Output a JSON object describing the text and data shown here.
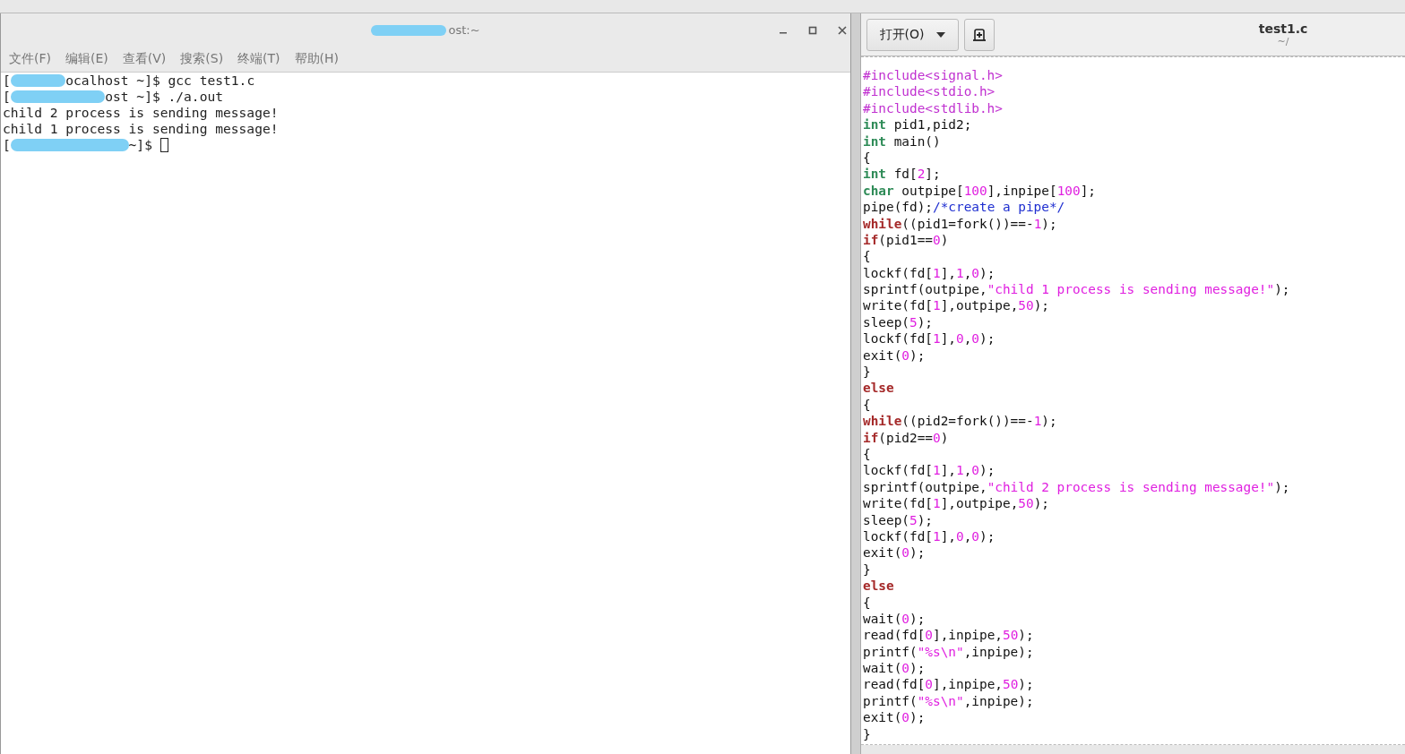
{
  "terminal": {
    "title": "ost:~",
    "menu": [
      "文件(F)",
      "编辑(E)",
      "查看(V)",
      "搜索(S)",
      "终端(T)",
      "帮助(H)"
    ],
    "lines": [
      {
        "prefix": "[",
        "text": "ocalhost ~]$ gcc test1.c",
        "redacted": true,
        "cursor": false
      },
      {
        "prefix": "[",
        "text": "ost ~]$ ./a.out",
        "redacted": true,
        "cursor": false
      },
      {
        "text": "child 2 process is sending message!",
        "redacted": false,
        "cursor": false
      },
      {
        "text": "child 1 process is sending message!",
        "redacted": false,
        "cursor": false
      },
      {
        "prefix": "[",
        "text": "~]$",
        "redacted": true,
        "cursor": true
      }
    ]
  },
  "editor": {
    "open_button": "打开(O)",
    "title": "test1.c",
    "subtitle": "~/",
    "code": [
      [
        {
          "kind": "pre",
          "text": "#include<signal.h>"
        }
      ],
      [
        {
          "kind": "pre",
          "text": "#include<stdio.h>"
        }
      ],
      [
        {
          "kind": "pre",
          "text": "#include<stdlib.h>"
        }
      ],
      [
        {
          "kind": "type",
          "text": "int"
        },
        {
          "kind": "plain",
          "text": " pid1,pid2;"
        }
      ],
      [
        {
          "kind": "type",
          "text": "int"
        },
        {
          "kind": "plain",
          "text": " main()"
        }
      ],
      [
        {
          "kind": "plain",
          "text": "{"
        }
      ],
      [
        {
          "kind": "type",
          "text": "int"
        },
        {
          "kind": "plain",
          "text": " fd["
        },
        {
          "kind": "num",
          "text": "2"
        },
        {
          "kind": "plain",
          "text": "];"
        }
      ],
      [
        {
          "kind": "type",
          "text": "char"
        },
        {
          "kind": "plain",
          "text": " outpipe["
        },
        {
          "kind": "num",
          "text": "100"
        },
        {
          "kind": "plain",
          "text": "],inpipe["
        },
        {
          "kind": "num",
          "text": "100"
        },
        {
          "kind": "plain",
          "text": "];"
        }
      ],
      [
        {
          "kind": "plain",
          "text": "pipe(fd);"
        },
        {
          "kind": "comment",
          "text": "/*create a pipe*/"
        }
      ],
      [
        {
          "kind": "keyword",
          "text": "while"
        },
        {
          "kind": "plain",
          "text": "((pid1=fork())==-"
        },
        {
          "kind": "num",
          "text": "1"
        },
        {
          "kind": "plain",
          "text": ");"
        }
      ],
      [
        {
          "kind": "keyword",
          "text": "if"
        },
        {
          "kind": "plain",
          "text": "(pid1=="
        },
        {
          "kind": "num",
          "text": "0"
        },
        {
          "kind": "plain",
          "text": ")"
        }
      ],
      [
        {
          "kind": "plain",
          "text": "{"
        }
      ],
      [
        {
          "kind": "plain",
          "text": "lockf(fd["
        },
        {
          "kind": "num",
          "text": "1"
        },
        {
          "kind": "plain",
          "text": "],"
        },
        {
          "kind": "num",
          "text": "1"
        },
        {
          "kind": "plain",
          "text": ","
        },
        {
          "kind": "num",
          "text": "0"
        },
        {
          "kind": "plain",
          "text": ");"
        }
      ],
      [
        {
          "kind": "plain",
          "text": "sprintf(outpipe,"
        },
        {
          "kind": "str",
          "text": "\"child 1 process is sending message!\""
        },
        {
          "kind": "plain",
          "text": ");"
        }
      ],
      [
        {
          "kind": "plain",
          "text": "write(fd["
        },
        {
          "kind": "num",
          "text": "1"
        },
        {
          "kind": "plain",
          "text": "],outpipe,"
        },
        {
          "kind": "num",
          "text": "50"
        },
        {
          "kind": "plain",
          "text": ");"
        }
      ],
      [
        {
          "kind": "plain",
          "text": "sleep("
        },
        {
          "kind": "num",
          "text": "5"
        },
        {
          "kind": "plain",
          "text": ");"
        }
      ],
      [
        {
          "kind": "plain",
          "text": "lockf(fd["
        },
        {
          "kind": "num",
          "text": "1"
        },
        {
          "kind": "plain",
          "text": "],"
        },
        {
          "kind": "num",
          "text": "0"
        },
        {
          "kind": "plain",
          "text": ","
        },
        {
          "kind": "num",
          "text": "0"
        },
        {
          "kind": "plain",
          "text": ");"
        }
      ],
      [
        {
          "kind": "plain",
          "text": "exit("
        },
        {
          "kind": "num",
          "text": "0"
        },
        {
          "kind": "plain",
          "text": ");"
        }
      ],
      [
        {
          "kind": "plain",
          "text": "}"
        }
      ],
      [
        {
          "kind": "keyword",
          "text": "else"
        }
      ],
      [
        {
          "kind": "plain",
          "text": "{"
        }
      ],
      [
        {
          "kind": "keyword",
          "text": "while"
        },
        {
          "kind": "plain",
          "text": "((pid2=fork())==-"
        },
        {
          "kind": "num",
          "text": "1"
        },
        {
          "kind": "plain",
          "text": ");"
        }
      ],
      [
        {
          "kind": "keyword",
          "text": "if"
        },
        {
          "kind": "plain",
          "text": "(pid2=="
        },
        {
          "kind": "num",
          "text": "0"
        },
        {
          "kind": "plain",
          "text": ")"
        }
      ],
      [
        {
          "kind": "plain",
          "text": "{"
        }
      ],
      [
        {
          "kind": "plain",
          "text": "lockf(fd["
        },
        {
          "kind": "num",
          "text": "1"
        },
        {
          "kind": "plain",
          "text": "],"
        },
        {
          "kind": "num",
          "text": "1"
        },
        {
          "kind": "plain",
          "text": ","
        },
        {
          "kind": "num",
          "text": "0"
        },
        {
          "kind": "plain",
          "text": ");"
        }
      ],
      [
        {
          "kind": "plain",
          "text": "sprintf(outpipe,"
        },
        {
          "kind": "str",
          "text": "\"child 2 process is sending message!\""
        },
        {
          "kind": "plain",
          "text": ");"
        }
      ],
      [
        {
          "kind": "plain",
          "text": "write(fd["
        },
        {
          "kind": "num",
          "text": "1"
        },
        {
          "kind": "plain",
          "text": "],outpipe,"
        },
        {
          "kind": "num",
          "text": "50"
        },
        {
          "kind": "plain",
          "text": ");"
        }
      ],
      [
        {
          "kind": "plain",
          "text": "sleep("
        },
        {
          "kind": "num",
          "text": "5"
        },
        {
          "kind": "plain",
          "text": ");"
        }
      ],
      [
        {
          "kind": "plain",
          "text": "lockf(fd["
        },
        {
          "kind": "num",
          "text": "1"
        },
        {
          "kind": "plain",
          "text": "],"
        },
        {
          "kind": "num",
          "text": "0"
        },
        {
          "kind": "plain",
          "text": ","
        },
        {
          "kind": "num",
          "text": "0"
        },
        {
          "kind": "plain",
          "text": ");"
        }
      ],
      [
        {
          "kind": "plain",
          "text": "exit("
        },
        {
          "kind": "num",
          "text": "0"
        },
        {
          "kind": "plain",
          "text": ");"
        }
      ],
      [
        {
          "kind": "plain",
          "text": "}"
        }
      ],
      [
        {
          "kind": "keyword",
          "text": "else"
        }
      ],
      [
        {
          "kind": "plain",
          "text": "{"
        }
      ],
      [
        {
          "kind": "plain",
          "text": "wait("
        },
        {
          "kind": "num",
          "text": "0"
        },
        {
          "kind": "plain",
          "text": ");"
        }
      ],
      [
        {
          "kind": "plain",
          "text": "read(fd["
        },
        {
          "kind": "num",
          "text": "0"
        },
        {
          "kind": "plain",
          "text": "],inpipe,"
        },
        {
          "kind": "num",
          "text": "50"
        },
        {
          "kind": "plain",
          "text": ");"
        }
      ],
      [
        {
          "kind": "plain",
          "text": "printf("
        },
        {
          "kind": "str",
          "text": "\"%s\\n\""
        },
        {
          "kind": "plain",
          "text": ",inpipe);"
        }
      ],
      [
        {
          "kind": "plain",
          "text": "wait("
        },
        {
          "kind": "num",
          "text": "0"
        },
        {
          "kind": "plain",
          "text": ");"
        }
      ],
      [
        {
          "kind": "plain",
          "text": "read(fd["
        },
        {
          "kind": "num",
          "text": "0"
        },
        {
          "kind": "plain",
          "text": "],inpipe,"
        },
        {
          "kind": "num",
          "text": "50"
        },
        {
          "kind": "plain",
          "text": ");"
        }
      ],
      [
        {
          "kind": "plain",
          "text": "printf("
        },
        {
          "kind": "str",
          "text": "\"%s\\n\""
        },
        {
          "kind": "plain",
          "text": ",inpipe);"
        }
      ],
      [
        {
          "kind": "plain",
          "text": "exit("
        },
        {
          "kind": "num",
          "text": "0"
        },
        {
          "kind": "plain",
          "text": ");"
        }
      ],
      [
        {
          "kind": "plain",
          "text": "}"
        }
      ]
    ]
  }
}
